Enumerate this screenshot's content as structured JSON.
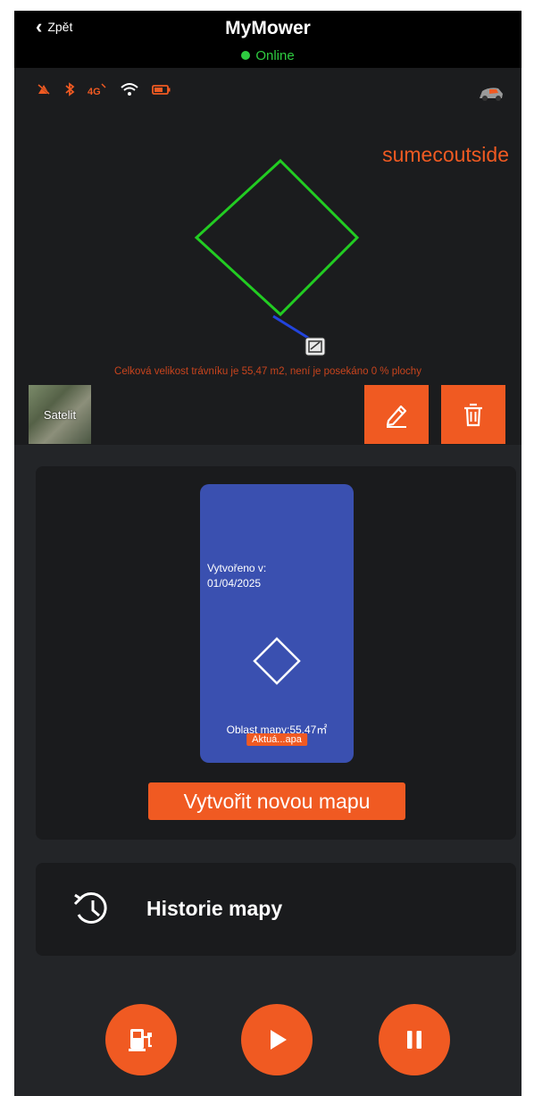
{
  "header": {
    "back_label": "Zpět",
    "title": "MyMower",
    "status": "Online"
  },
  "status_icons": [
    "gps-off-icon",
    "bluetooth-icon",
    "4g-icon",
    "wifi-icon",
    "battery-icon"
  ],
  "map": {
    "name": "sumecoutside",
    "area_text": "Celková velikost trávníku je 55,47 m2, není je posekáno 0 % plochy",
    "satellite_label": "Satelit"
  },
  "card": {
    "created_label": "Vytvořeno v:",
    "created_date": "01/04/2025",
    "area_label": "Oblast mapy:55.47㎡",
    "badge": "Aktuá...apa",
    "create_button": "Vytvořit novou mapu"
  },
  "history": {
    "label": "Historie mapy"
  },
  "colors": {
    "accent": "#f05a22",
    "online": "#2ecc40",
    "boundary": "#22cc22",
    "tile": "#3a50b0"
  }
}
